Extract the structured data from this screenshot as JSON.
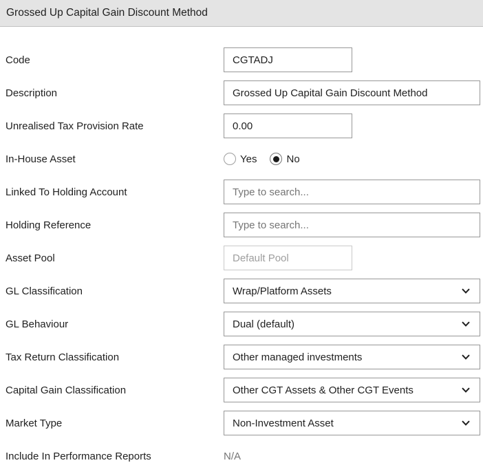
{
  "header": {
    "title": "Grossed Up Capital Gain Discount Method"
  },
  "colors": {
    "header_bg": "#e4e4e4",
    "header_border": "#c2c2c2",
    "input_border": "#979797",
    "disabled_border": "#c9c9c9",
    "placeholder_text": "#757575",
    "label_text": "#212121",
    "radio_selected_dot": "#1a1a1a"
  },
  "form": {
    "code": {
      "label": "Code",
      "value": "CGTADJ"
    },
    "description": {
      "label": "Description",
      "value": "Grossed Up Capital Gain Discount Method"
    },
    "unrealised_tax_provision_rate": {
      "label": "Unrealised Tax Provision Rate",
      "value": "0.00"
    },
    "in_house_asset": {
      "label": "In-House Asset",
      "options": [
        "Yes",
        "No"
      ],
      "selected": "No"
    },
    "linked_to_holding_account": {
      "label": "Linked To Holding Account",
      "placeholder": "Type to search..."
    },
    "holding_reference": {
      "label": "Holding Reference",
      "placeholder": "Type to search..."
    },
    "asset_pool": {
      "label": "Asset Pool",
      "placeholder": "Default Pool",
      "state": "disabled"
    },
    "gl_classification": {
      "label": "GL Classification",
      "value": "Wrap/Platform Assets"
    },
    "gl_behaviour": {
      "label": "GL Behaviour",
      "value": "Dual (default)"
    },
    "tax_return_classification": {
      "label": "Tax Return Classification",
      "value": "Other managed investments"
    },
    "capital_gain_classification": {
      "label": "Capital Gain Classification",
      "value": "Other CGT Assets & Other CGT Events"
    },
    "market_type": {
      "label": "Market Type",
      "value": "Non-Investment Asset"
    },
    "include_in_performance_reports": {
      "label": "Include In Performance Reports",
      "value": "N/A"
    }
  }
}
